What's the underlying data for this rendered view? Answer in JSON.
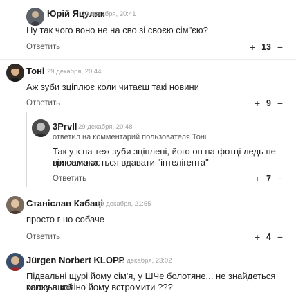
{
  "icons": {
    "upvote": "plus-icon",
    "downvote": "minus-icon",
    "avatar": "user-avatar-icon"
  },
  "comments": [
    {
      "author": "Юрій Яцуляк",
      "time": "29 декабря, 20:41",
      "text": "Ну так чого воно не на сво зі своєю сім\"єю?",
      "reply_label": "Ответить",
      "score": "13"
    },
    {
      "author": "Тоні",
      "time": "29 декабря, 20:44",
      "text": "Аж зуби зціплює коли читаєш такі новини",
      "reply_label": "Ответить",
      "score": "9"
    },
    {
      "author": "3PrvII",
      "time": "29 декабря, 20:48",
      "reply_note_prefix": "ответил на комментарий пользователя ",
      "reply_to": "Тоні",
      "text_line1": "Так у к     па теж зуби зціплені, його он на фотці ледь не трясе поки",
      "text_line2": "він намагається вдавати \"інтелігента\"",
      "reply_label": "Ответить",
      "score": "7"
    },
    {
      "author": "Станіслав Кабаці",
      "time": "29 декабря, 21:55",
      "text": "просто г     но собаче",
      "reply_label": "Ответить",
      "score": "4"
    },
    {
      "author": "Jürgen Norbert KLOPP",
      "time": "29 декабря, 23:02",
      "text_line1": "Підвальні щурі йому сім'я, у        ШЧе болотяне... не знайдеться когось щоб",
      "text_line2": "палку в коліно йому встромити ???"
    }
  ],
  "vote_plus": "+",
  "vote_minus": "−"
}
